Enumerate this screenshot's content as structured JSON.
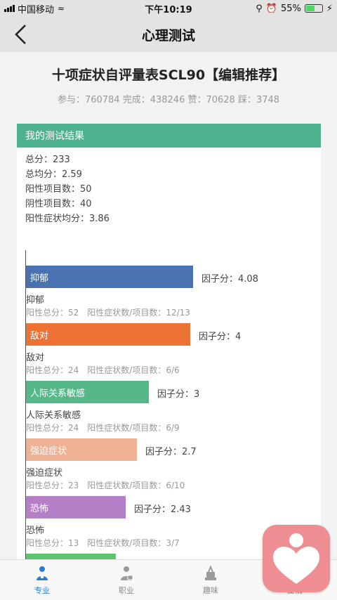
{
  "status_bar": {
    "carrier": "中国移动",
    "time": "下午10:19",
    "battery_percent": "55%",
    "battery_level": 0.55
  },
  "nav": {
    "title": "心理测试"
  },
  "test": {
    "title": "十项症状自评量表SCL90【编辑推荐】",
    "stats": "参与：760784 完成：438246 赞：70628 踩：3748"
  },
  "result": {
    "header": "我的测试结果",
    "summary": [
      "总分：233",
      "总均分：2.59",
      "阳性项目数：50",
      "阴性项目数：40",
      "阳性症状均分：3.86"
    ]
  },
  "chart_data": {
    "type": "bar",
    "orientation": "horizontal",
    "categories": [
      "抑郁",
      "敌对",
      "人际关系敏感",
      "强迫症状",
      "恐怖"
    ],
    "values": [
      4.08,
      4,
      3,
      2.7,
      2.43
    ],
    "xlim": [
      0,
      5
    ],
    "value_prefix": "因子分：",
    "colors": [
      "#4a72b0",
      "#ec7236",
      "#56b889",
      "#efb194",
      "#b57fc7",
      "#5fc472"
    ],
    "details": [
      "阳性总分：52　阳性症状数/项目数：12/13",
      "阳性总分：24　阳性症状数/项目数：6/6",
      "阳性总分：24　阳性症状数/项目数：6/9",
      "阳性总分：23　阳性症状数/项目数：6/10",
      "阳性总分：13　阳性症状数/项目数：3/7"
    ]
  },
  "tabs": [
    {
      "label": "专业",
      "icon": "doctor-icon",
      "active": true
    },
    {
      "label": "职业",
      "icon": "briefcase-person-icon",
      "active": false
    },
    {
      "label": "趣味",
      "icon": "fun-icon",
      "active": false
    },
    {
      "label": "爱情",
      "icon": "heart-icon",
      "active": false
    }
  ],
  "fab": {
    "icon": "person-heart-icon",
    "color": "#ee8e93"
  }
}
